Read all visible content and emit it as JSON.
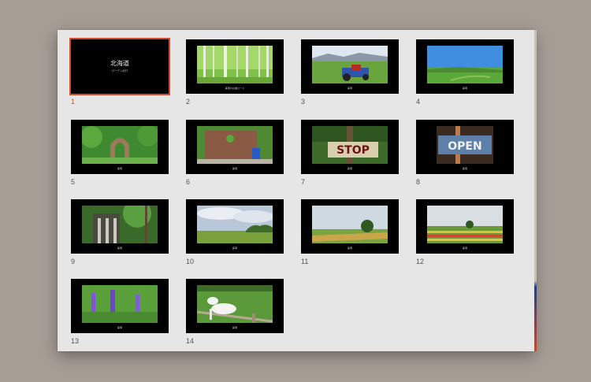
{
  "slides": [
    {
      "num": "1",
      "selected": true,
      "title": "北海道",
      "subtitle": "ガーデン紀行"
    },
    {
      "num": "2",
      "caption": "美瑛の白樺ロード"
    },
    {
      "num": "3",
      "caption": "美瑛"
    },
    {
      "num": "4",
      "caption": "美瑛"
    },
    {
      "num": "5",
      "caption": "美瑛"
    },
    {
      "num": "6",
      "caption": "美瑛"
    },
    {
      "num": "7",
      "caption": "美瑛",
      "sign": "STOP"
    },
    {
      "num": "8",
      "caption": "美瑛",
      "sign": "OPEN"
    },
    {
      "num": "9",
      "caption": "美瑛"
    },
    {
      "num": "10",
      "caption": "美瑛"
    },
    {
      "num": "11",
      "caption": "美瑛"
    },
    {
      "num": "12",
      "caption": "美瑛"
    },
    {
      "num": "13",
      "caption": "美瑛"
    },
    {
      "num": "14",
      "caption": "美瑛"
    }
  ],
  "colors": {
    "selection": "#d24b2a",
    "window_bg": "#e6e6e6",
    "desktop_bg": "#a69d95"
  }
}
